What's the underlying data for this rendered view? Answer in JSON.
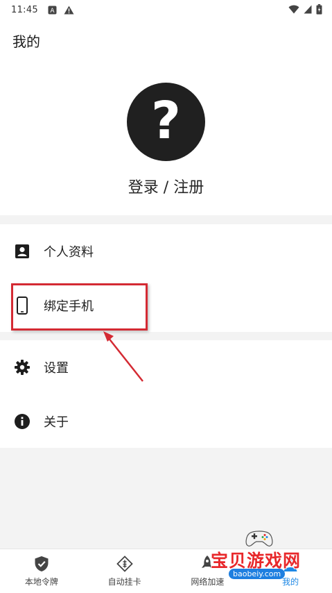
{
  "status_bar": {
    "time": "11:45",
    "left_icons": [
      "a-badge-icon",
      "warning-icon"
    ],
    "right_icons": [
      "wifi-icon",
      "signal-icon",
      "battery-icon"
    ]
  },
  "appbar": {
    "title": "我的"
  },
  "profile": {
    "avatar_glyph": "?",
    "login_text": "登录 / 注册"
  },
  "menu": {
    "items": [
      {
        "label": "个人资料",
        "icon": "contact-card-icon"
      },
      {
        "label": "绑定手机",
        "icon": "phone-icon"
      },
      {
        "label": "设置",
        "icon": "gear-icon"
      },
      {
        "label": "关于",
        "icon": "info-icon"
      }
    ]
  },
  "bottom_nav": {
    "tabs": [
      {
        "label": "本地令牌",
        "icon": "shield-check-icon",
        "active": false
      },
      {
        "label": "自动挂卡",
        "icon": "diamond-card-icon",
        "active": false
      },
      {
        "label": "网络加速",
        "icon": "rocket-icon",
        "active": false
      },
      {
        "label": "我的",
        "icon": "person-icon",
        "active": true
      }
    ]
  },
  "watermark": {
    "title": "宝贝游戏网",
    "url": "baobeiy.com"
  },
  "colors": {
    "accent": "#1e88e5",
    "highlight": "#d42a33",
    "background": "#f3f3f3"
  }
}
